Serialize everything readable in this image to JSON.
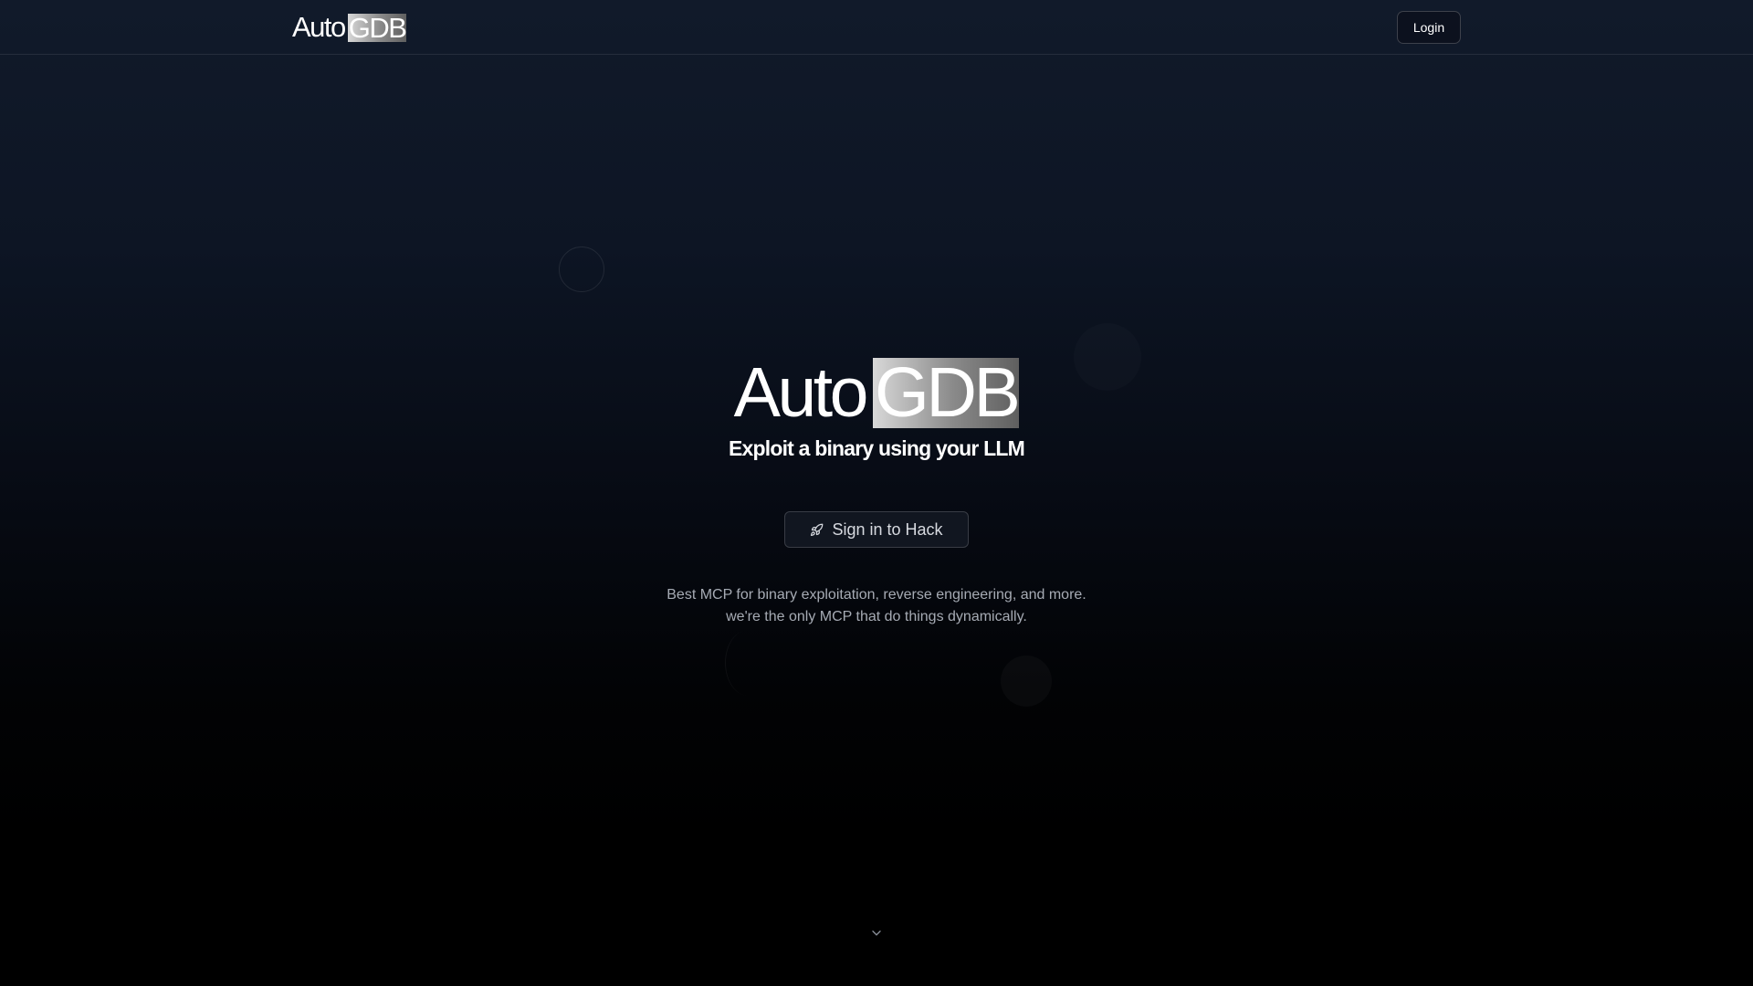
{
  "nav": {
    "logo_text": "Auto",
    "logo_box_text": "GDB",
    "login_label": "Login"
  },
  "hero": {
    "title_text": "Auto",
    "title_box_text": "GDB",
    "tagline": "Exploit a binary using your LLM",
    "cta_icon": "rocket-icon",
    "cta_label": "Sign in to Hack",
    "description_line1": "Best MCP for binary exploitation, reverse engineering, and more.",
    "description_line2": "we're the only MCP that do things dynamically."
  },
  "scroll_indicator": {
    "icon": "chevron-down-icon"
  },
  "colors": {
    "background_top": "#111a2a",
    "background_bottom": "#000000",
    "text_primary": "#ffffff",
    "text_muted": "#a6abb4"
  }
}
